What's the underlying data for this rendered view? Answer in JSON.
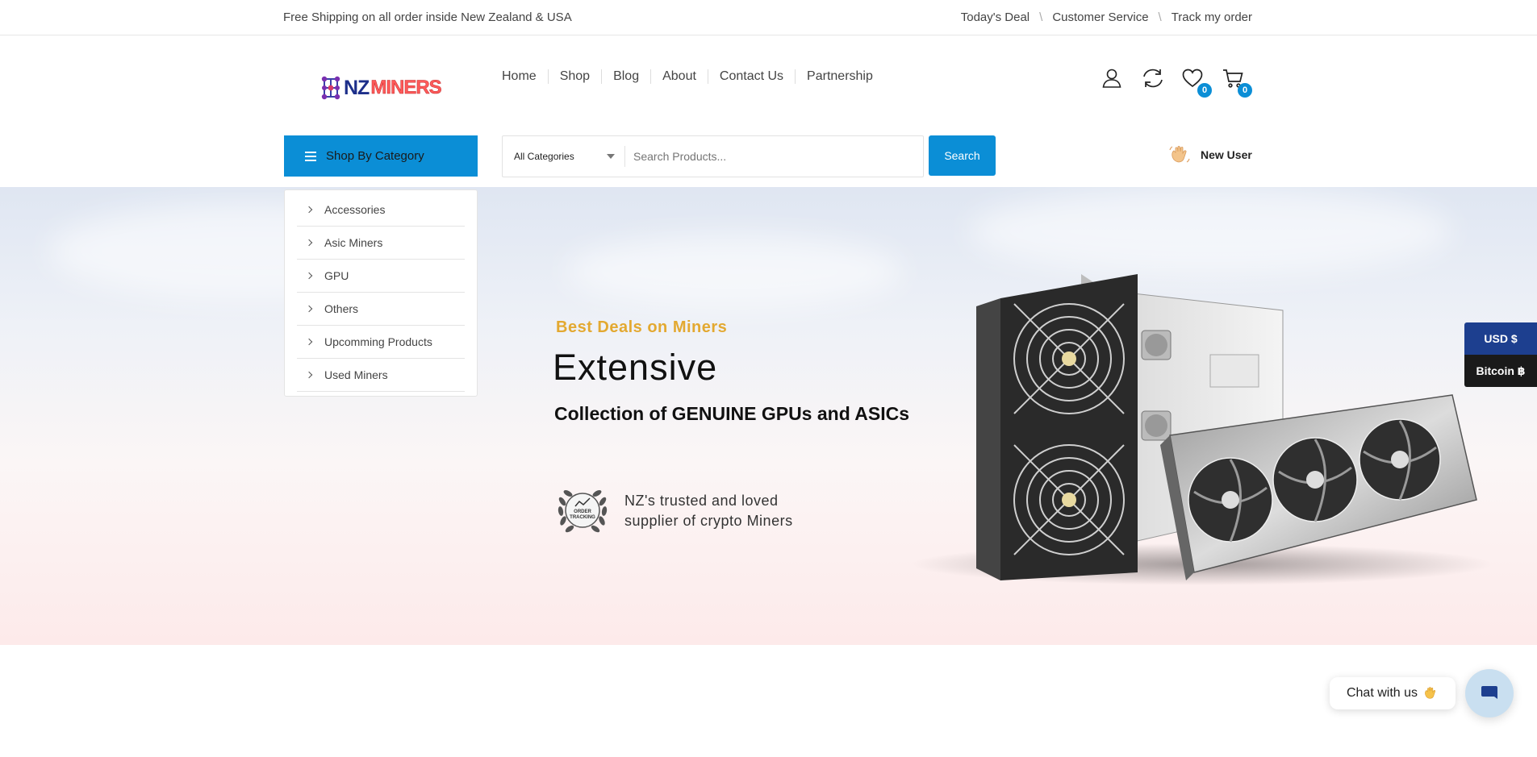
{
  "topbar": {
    "shipping_text": "Free Shipping on all order inside New Zealand & USA",
    "links": [
      "Today's Deal",
      "Customer Service",
      "Track my order"
    ]
  },
  "logo": {
    "part1": "NZ",
    "part2": "MINERS"
  },
  "nav": {
    "items": [
      "Home",
      "Shop",
      "Blog",
      "About",
      "Contact Us",
      "Partnership"
    ]
  },
  "header_icons": {
    "wishlist_count": "0",
    "cart_count": "0"
  },
  "shop_by_category": {
    "label": "Shop By Category",
    "items": [
      "Accessories",
      "Asic Miners",
      "GPU",
      "Others",
      "Upcomming Products",
      "Used Miners"
    ]
  },
  "search": {
    "category_selected": "All Categories",
    "placeholder": "Search Products...",
    "button_label": "Search"
  },
  "user": {
    "label": "New User"
  },
  "hero": {
    "subtitle": "Best Deals on Miners",
    "title": "Extensive",
    "line": "Collection of GENUINE GPUs and ASICs",
    "seal_text_line1": "ORDER",
    "seal_text_line2": "TRACKING",
    "trust_line1": "NZ's trusted and loved",
    "trust_line2": "supplier of crypto Miners"
  },
  "currency": {
    "usd": "USD $",
    "bitcoin": "Bitcoin ฿"
  },
  "chat": {
    "label": "Chat with us"
  },
  "colors": {
    "accent": "#0b8ed6",
    "gold": "#e3a931",
    "usd_bg": "#1d3f8f",
    "btc_bg": "#1a1a1a"
  }
}
